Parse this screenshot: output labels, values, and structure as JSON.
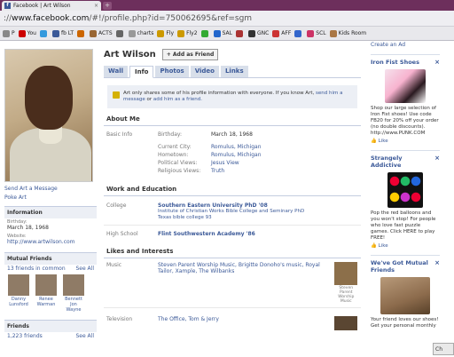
{
  "browser": {
    "tab_title": "Facebook | Art Wilson",
    "tab_close": "×",
    "new_tab": "+",
    "url_scheme": "://",
    "url_host": "www.facebook.com",
    "url_rest": "/#!/profile.php?id=750062695&ref=sgm",
    "bookmarks": [
      {
        "label": "P",
        "color": "#888888"
      },
      {
        "label": "You",
        "color": "#cc0000"
      },
      {
        "label": "",
        "color": "#3399dd"
      },
      {
        "label": "fb LT",
        "color": "#3b5998"
      },
      {
        "label": "",
        "color": "#cc6600"
      },
      {
        "label": "ACTS",
        "color": "#996633"
      },
      {
        "label": "",
        "color": "#666666"
      },
      {
        "label": "charts",
        "color": "#999999"
      },
      {
        "label": "Fly",
        "color": "#cc9900"
      },
      {
        "label": "Fly2",
        "color": "#cc9900"
      },
      {
        "label": "",
        "color": "#33aa33"
      },
      {
        "label": "SAL",
        "color": "#2266cc"
      },
      {
        "label": "",
        "color": "#aa3333"
      },
      {
        "label": "GNC",
        "color": "#333333"
      },
      {
        "label": "AFF",
        "color": "#cc3333"
      },
      {
        "label": "",
        "color": "#3366cc"
      },
      {
        "label": "SCL",
        "color": "#cc3366"
      },
      {
        "label": "Kids Room",
        "color": "#aa7744"
      }
    ]
  },
  "sidebar": {
    "send_message": "Send Art a Message",
    "poke": "Poke Art",
    "information_title": "Information",
    "birthday_label": "Birthday:",
    "birthday_value": "March 18, 1968",
    "website_label": "Website:",
    "website_value": "http://www.artwilson.com",
    "mutual_title": "Mutual Friends",
    "mutual_count": "13 friends in common",
    "see_all": "See All",
    "mutual_friends": [
      {
        "name": "Danny Lunsford"
      },
      {
        "name": "Renee Warman"
      },
      {
        "name": "Bennett Jon Wayne"
      }
    ],
    "friends_title": "Friends",
    "friends_count": "1,223 friends",
    "friends_see_all": "See All"
  },
  "profile": {
    "name": "Art Wilson",
    "add_friend": "+ Add as Friend",
    "tabs": [
      {
        "label": "Wall"
      },
      {
        "label": "Info"
      },
      {
        "label": "Photos"
      },
      {
        "label": "Video"
      },
      {
        "label": "Links"
      }
    ],
    "notice_text": "Art only shares some of his profile information with everyone. If you know Art,",
    "notice_link1": "send him a message",
    "notice_or": "or",
    "notice_link2": "add him as a friend.",
    "about_title": "About Me",
    "basic_info_label": "Basic Info",
    "birthday_label": "Birthday:",
    "birthday_value": "March 18, 1968",
    "current_city_label": "Current City:",
    "current_city_value": "Romulus, Michigan",
    "hometown_label": "Hometown:",
    "hometown_value": "Romulus, Michigan",
    "political_label": "Political Views:",
    "political_value": "Jesus View",
    "religious_label": "Religious Views:",
    "religious_value": "Truth",
    "work_title": "Work and Education",
    "college_label": "College",
    "college_name": "Southern Eastern University PhD '08",
    "college_sub1": "Institute of Christian Works Bible College and Seminary PhD",
    "college_sub2": "Texas bible college 93",
    "highschool_label": "High School",
    "highschool_name": "Flint Southwestern Academy '86",
    "likes_title": "Likes and Interests",
    "music_label": "Music",
    "music_value": "Steven Parent Worship Music, Brigitte Donoho's music, Royal Tailor, Xample, The Wilbanks",
    "music_thumb": "Steven Parent Worship Music",
    "tv_label": "Television",
    "tv_value": "The Office, Tom & Jerry"
  },
  "ads": {
    "create_ad": "Create an Ad",
    "items": [
      {
        "title": "Iron Fist Shoes",
        "text": "Shop our large selection of Iron Fist shoes! Use code FB20 for 20% off your order (no double discounts). http://www.PUNK.COM",
        "like": "Like"
      },
      {
        "title": "Strangely Addictive",
        "text": "Pop the red balloons and you won't stop! For people who love fast puzzle games. Click HERE to play FREE!",
        "like": "Like"
      },
      {
        "title": "We've Got Mutual Friends",
        "text": "Your friend loves our shoes! Get your personal monthly",
        "like": ""
      }
    ]
  },
  "chat": "Ch"
}
